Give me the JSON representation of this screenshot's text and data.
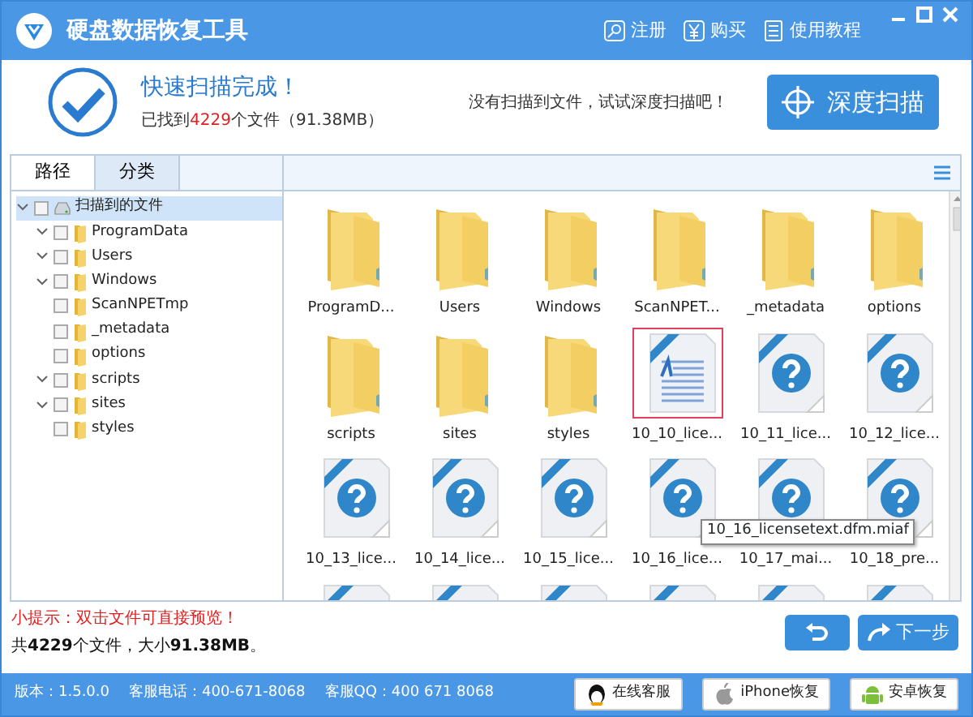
{
  "window": {
    "title": "硬盘数据恢复工具",
    "toolbar": [
      {
        "kind": "register",
        "label": "注册"
      },
      {
        "kind": "buy",
        "label": "购买"
      },
      {
        "kind": "tutorial",
        "label": "使用教程"
      }
    ]
  },
  "scan": {
    "title": "快速扫描完成！",
    "found_prefix": "已找到",
    "found_count": "4229",
    "found_suffix": "个文件（91.38MB）",
    "hint": "没有扫描到文件，试试深度扫描吧！",
    "deep_scan_button": "深度扫描"
  },
  "tabs": [
    {
      "label": "路径",
      "selected": true
    },
    {
      "label": "分类",
      "selected": false
    }
  ],
  "tree": [
    {
      "label": "扫描到的文件",
      "kind": "drive",
      "expanded": true,
      "checked": false,
      "selected": true,
      "children": [
        {
          "label": "ProgramData",
          "kind": "folder",
          "expanded": true,
          "checked": false,
          "selected": false
        },
        {
          "label": "Users",
          "kind": "folder",
          "expanded": true,
          "checked": false,
          "selected": false
        },
        {
          "label": "Windows",
          "kind": "folder",
          "expanded": true,
          "checked": false,
          "selected": false
        },
        {
          "label": "ScanNPETmp",
          "kind": "folder",
          "expanded": false,
          "checked": false,
          "selected": false
        },
        {
          "label": "_metadata",
          "kind": "folder",
          "expanded": false,
          "checked": false,
          "selected": false
        },
        {
          "label": "options",
          "kind": "folder",
          "expanded": false,
          "checked": false,
          "selected": false
        },
        {
          "label": "scripts",
          "kind": "folder",
          "expanded": true,
          "checked": false,
          "selected": false
        },
        {
          "label": "sites",
          "kind": "folder",
          "expanded": true,
          "checked": false,
          "selected": false
        },
        {
          "label": "styles",
          "kind": "folder",
          "expanded": false,
          "checked": false,
          "selected": false
        }
      ]
    }
  ],
  "files": [
    {
      "name": "ProgramD...",
      "kind": "folder",
      "selected": false
    },
    {
      "name": "Users",
      "kind": "folder",
      "selected": false
    },
    {
      "name": "Windows",
      "kind": "folder",
      "selected": false
    },
    {
      "name": "ScanNPET...",
      "kind": "folder",
      "selected": false
    },
    {
      "name": "_metadata",
      "kind": "folder",
      "selected": false
    },
    {
      "name": "options",
      "kind": "folder",
      "selected": false
    },
    {
      "name": "scripts",
      "kind": "folder",
      "selected": false
    },
    {
      "name": "sites",
      "kind": "folder",
      "selected": false
    },
    {
      "name": "styles",
      "kind": "folder",
      "selected": false
    },
    {
      "name": "10_10_lice...",
      "kind": "document",
      "selected": true
    },
    {
      "name": "10_11_lice...",
      "kind": "lost",
      "selected": false
    },
    {
      "name": "10_12_lice...",
      "kind": "lost",
      "selected": false
    },
    {
      "name": "10_13_lice...",
      "kind": "lost",
      "selected": false
    },
    {
      "name": "10_14_lice...",
      "kind": "lost",
      "selected": false
    },
    {
      "name": "10_15_lice...",
      "kind": "lost",
      "selected": false
    },
    {
      "name": "10_16_lice...",
      "kind": "lost",
      "selected": false,
      "tooltip": "10_16_licensetext.dfm.miaf"
    },
    {
      "name": "10_17_mai...",
      "kind": "lost",
      "selected": false
    },
    {
      "name": "10_18_pre...",
      "kind": "lost",
      "selected": false
    },
    {
      "kind": "lost",
      "selected": false
    },
    {
      "kind": "lost",
      "selected": false
    },
    {
      "kind": "lost",
      "selected": false
    },
    {
      "kind": "lost",
      "selected": false
    },
    {
      "kind": "lost",
      "selected": false
    },
    {
      "kind": "lost",
      "selected": false
    }
  ],
  "tip": "小提示：双击文件可直接预览！",
  "summary": "共**4229**个文件，大小**91.38MB**。",
  "next_button": "下一步",
  "status_bar": {
    "version": "版本：1.5.0.0",
    "phone": "客服电话：400-671-8068",
    "qq": "客服QQ：400 671 8068",
    "buttons": [
      {
        "kind": "online",
        "label": "在线客服"
      },
      {
        "kind": "iphone",
        "label": "iPhone恢复"
      },
      {
        "kind": "android",
        "label": "安卓恢复"
      }
    ]
  }
}
